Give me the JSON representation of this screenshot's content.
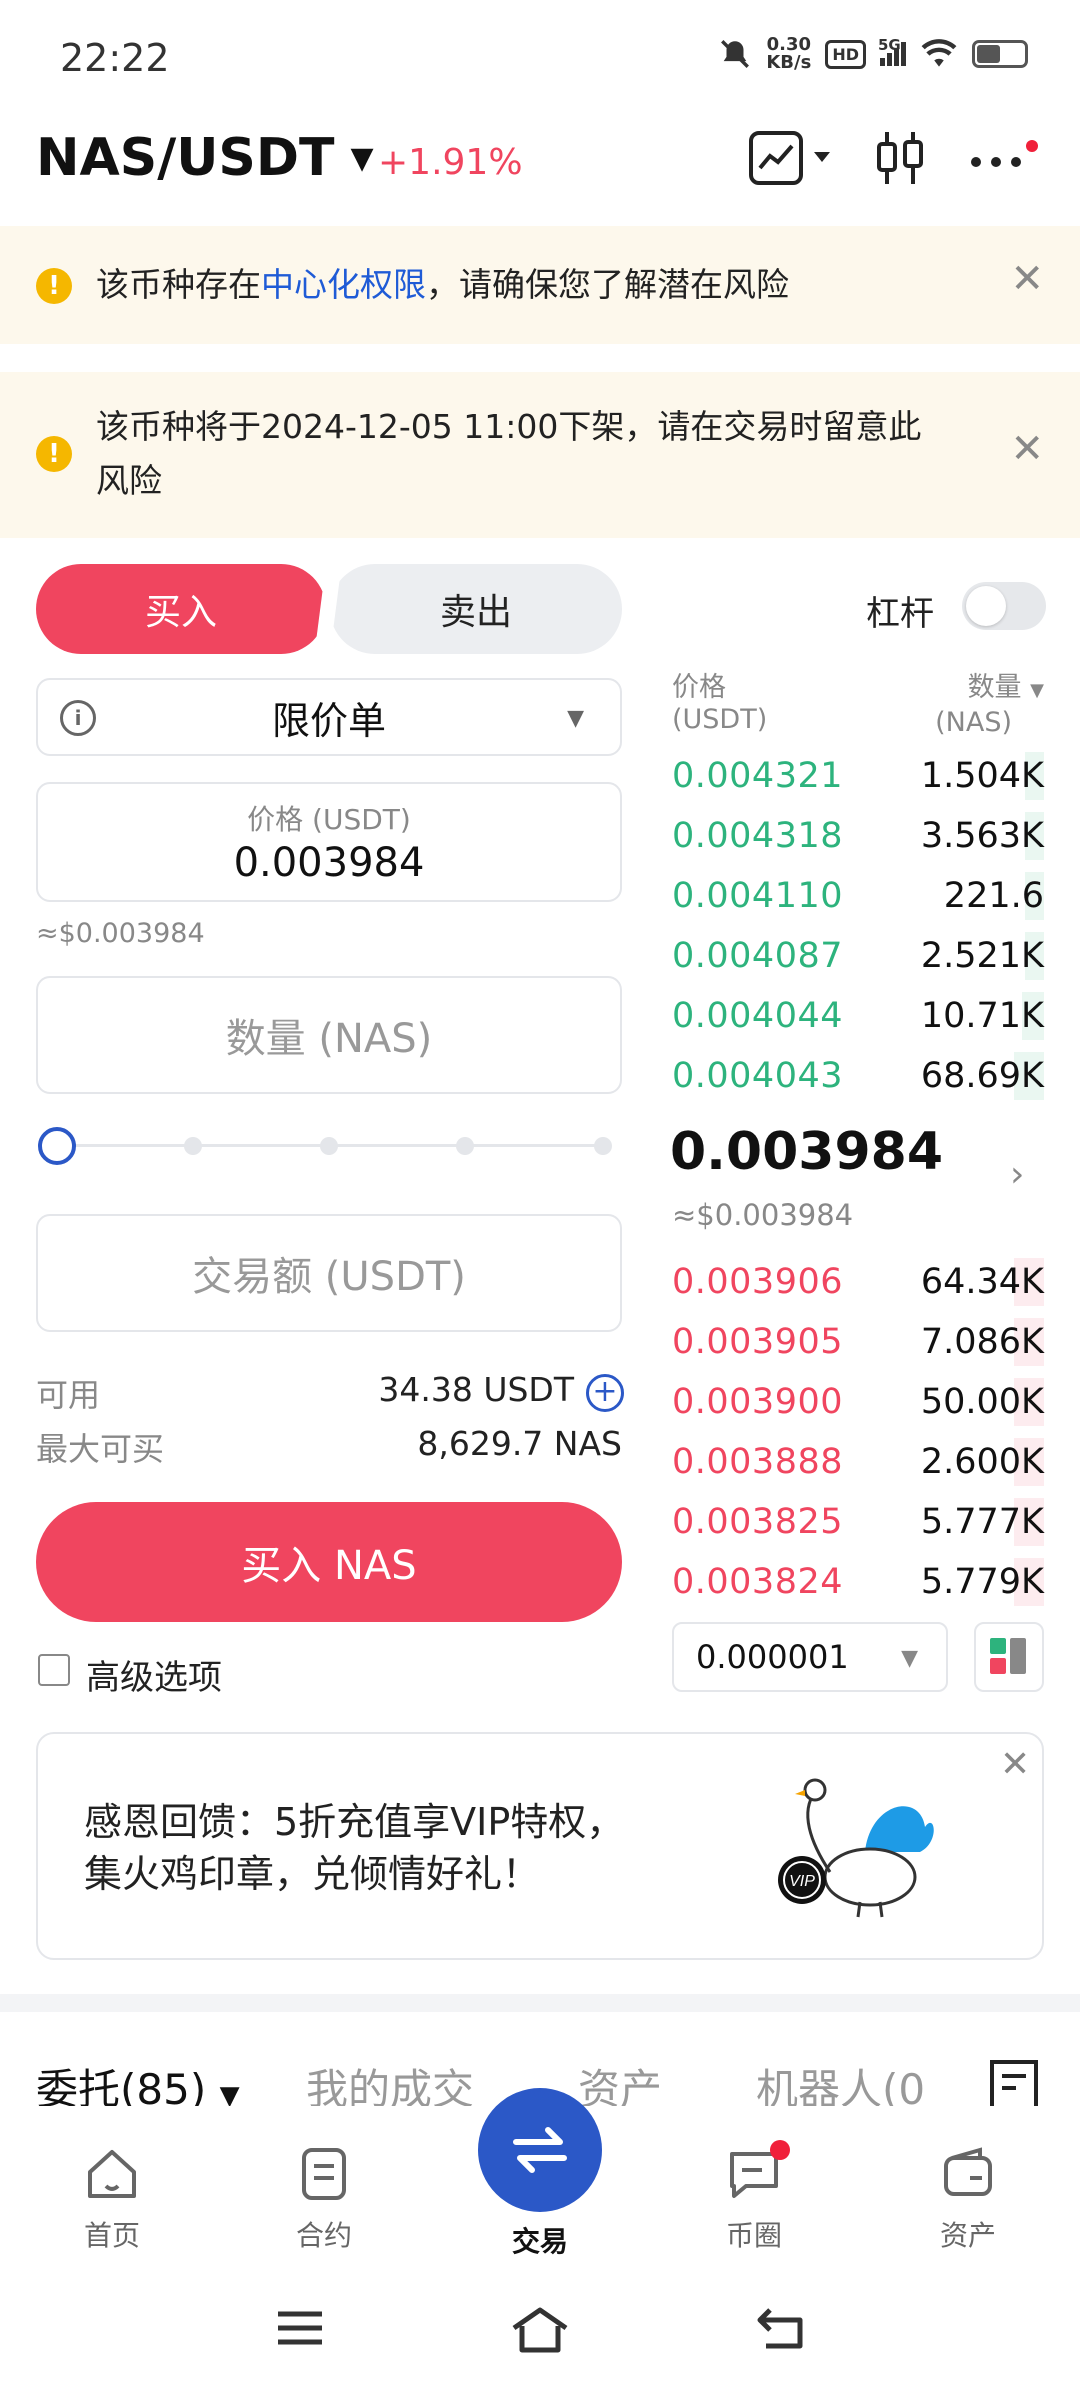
{
  "status_bar": {
    "time": "22:22",
    "net_speed_value": "0.30",
    "net_speed_unit": "KB/s",
    "hd": "HD",
    "net": "5G"
  },
  "header": {
    "pair": "NAS/USDT",
    "change": "+1.91%"
  },
  "banners": [
    {
      "text_before": "该币种存在",
      "link": "中心化权限",
      "text_after": "，请确保您了解潜在风险"
    },
    {
      "line1": "该币种将于2024-12-05 11:00下架，请在交易时留意此",
      "line2": "风险"
    }
  ],
  "trade": {
    "buy_tab": "买入",
    "sell_tab": "卖出",
    "leverage_label": "杠杆",
    "order_type": "限价单",
    "price_placeholder": "价格 (USDT)",
    "price_value": "0.003984",
    "price_approx": "≈$0.003984",
    "quantity_placeholder": "数量 (NAS)",
    "amount_placeholder": "交易额 (USDT)",
    "available_label": "可用",
    "available_value": "34.38 USDT",
    "max_buy_label": "最大可买",
    "max_buy_value": "8,629.7 NAS",
    "buy_button": "买入 NAS",
    "advanced_label": "高级选项"
  },
  "order_book": {
    "price_header": "价格",
    "price_unit": "(USDT)",
    "qty_header": "数量",
    "qty_unit": "(NAS)",
    "asks": [
      {
        "price": "0.004321",
        "qty": "1.504K",
        "depth": 0.05
      },
      {
        "price": "0.004318",
        "qty": "3.563K",
        "depth": 0.05
      },
      {
        "price": "0.004110",
        "qty": "221.6",
        "depth": 0.05
      },
      {
        "price": "0.004087",
        "qty": "2.521K",
        "depth": 0.05
      },
      {
        "price": "0.004044",
        "qty": "10.71K",
        "depth": 0.06
      },
      {
        "price": "0.004043",
        "qty": "68.69K",
        "depth": 0.08
      }
    ],
    "last_price": "0.003984",
    "last_price_approx": "≈$0.003984",
    "bids": [
      {
        "price": "0.003906",
        "qty": "64.34K",
        "depth": 0.08
      },
      {
        "price": "0.003905",
        "qty": "7.086K",
        "depth": 0.08
      },
      {
        "price": "0.003900",
        "qty": "50.00K",
        "depth": 0.08
      },
      {
        "price": "0.003888",
        "qty": "2.600K",
        "depth": 0.08
      },
      {
        "price": "0.003825",
        "qty": "5.777K",
        "depth": 0.08
      },
      {
        "price": "0.003824",
        "qty": "5.779K",
        "depth": 0.08
      }
    ],
    "precision": "0.000001"
  },
  "promo": {
    "line1": "感恩回馈：5折充值享VIP特权，",
    "line2": "集火鸡印章，兑倾情好礼！",
    "badge": "VIP"
  },
  "sub_tabs": [
    "委托(85)",
    "我的成交",
    "资产",
    "机器人(0"
  ],
  "nav": [
    {
      "label": "首页",
      "icon": "home-icon"
    },
    {
      "label": "合约",
      "icon": "contract-icon"
    },
    {
      "label": "交易",
      "icon": "swap-icon"
    },
    {
      "label": "币圈",
      "icon": "chat-icon"
    },
    {
      "label": "资产",
      "icon": "wallet-icon"
    }
  ],
  "colors": {
    "buy": "#f0455f",
    "ask": "#2db37d",
    "accent": "#2b58c7",
    "warn": "#f5b700",
    "banner_bg": "#fdf8ec"
  }
}
